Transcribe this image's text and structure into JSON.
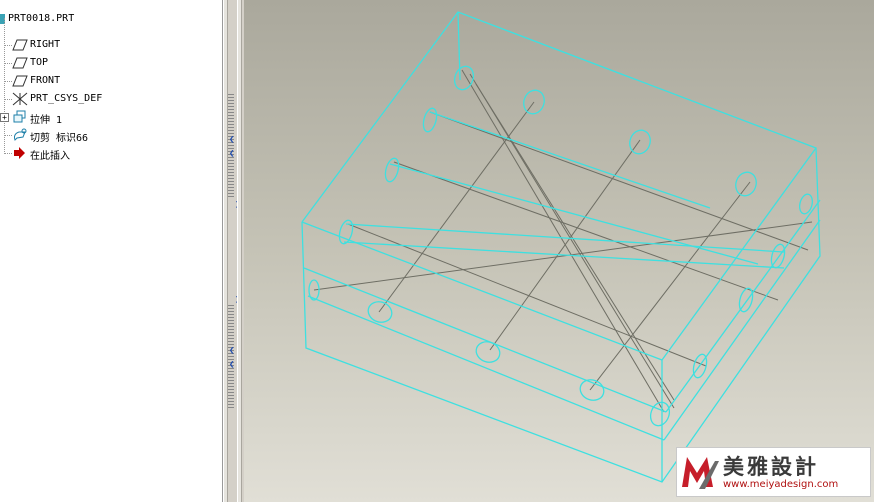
{
  "model_tree": {
    "root_label": "PRT0018.PRT",
    "items": [
      {
        "label": "RIGHT",
        "icon": "datum-plane-icon"
      },
      {
        "label": "TOP",
        "icon": "datum-plane-icon"
      },
      {
        "label": "FRONT",
        "icon": "datum-plane-icon"
      },
      {
        "label": "PRT_CSYS_DEF",
        "icon": "coordinate-system-icon"
      },
      {
        "label": "拉伸 1",
        "icon": "extrude-feature-icon"
      },
      {
        "label": "切剪 标识66",
        "icon": "cut-feature-icon"
      },
      {
        "label": "在此插入",
        "icon": "insert-here-icon"
      }
    ]
  },
  "watermark": {
    "title": "美雅設計",
    "url": "www.meiyadesign.com"
  },
  "colors": {
    "wireframe_edges": "#3ee0e0",
    "hidden_lines": "#6e6e64",
    "insert_arrow": "#c00000",
    "viewport_top": "#aaa89c",
    "viewport_bottom": "#e1dfd6"
  }
}
